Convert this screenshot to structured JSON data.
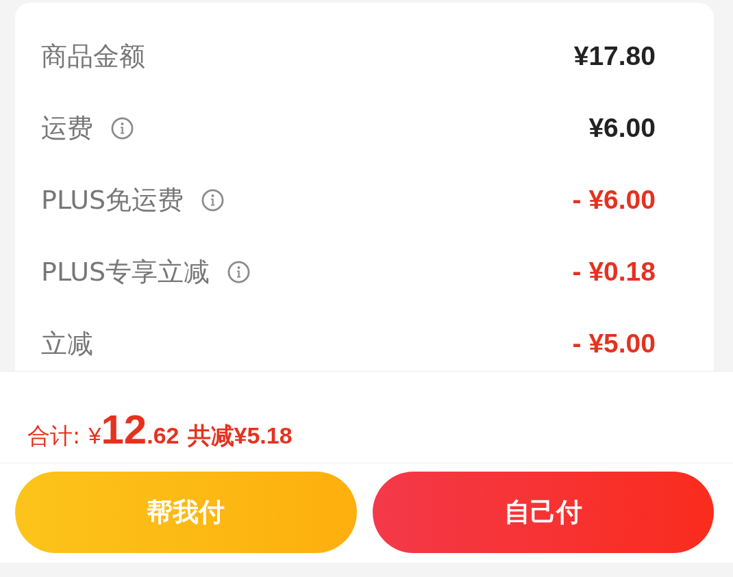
{
  "fees": [
    {
      "label": "商品金额",
      "info": false,
      "amount": "¥17.80",
      "kind": "charge"
    },
    {
      "label": "运费",
      "info": true,
      "amount": "¥6.00",
      "kind": "charge"
    },
    {
      "label": "PLUS免运费",
      "info": true,
      "amount": "- ¥6.00",
      "kind": "discount"
    },
    {
      "label": "PLUS专享立减",
      "info": true,
      "amount": "- ¥0.18",
      "kind": "discount"
    },
    {
      "label": "立减",
      "info": false,
      "amount": "- ¥5.00",
      "kind": "discount"
    }
  ],
  "total": {
    "label": "合计:",
    "currency": "¥",
    "integer": "12",
    "decimal": ".62",
    "saving": "共减¥5.18"
  },
  "buttons": [
    {
      "label": "帮我付",
      "kind": "secondary"
    },
    {
      "label": "自己付",
      "kind": "primary"
    }
  ]
}
